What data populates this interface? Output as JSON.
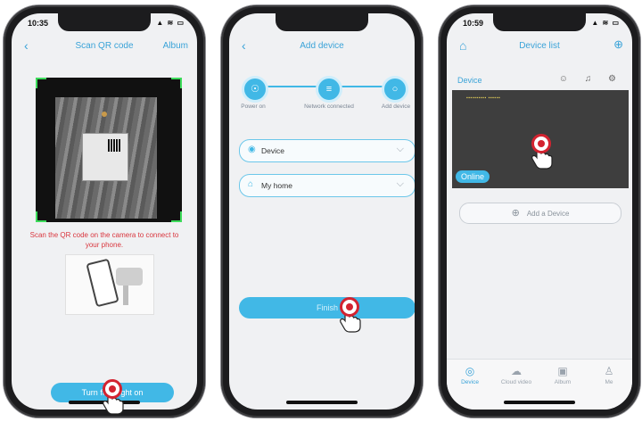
{
  "screens": [
    {
      "status": {
        "time": "10:35",
        "icons": "▲ ≋ ▭"
      },
      "nav": {
        "back": "‹",
        "title": "Scan QR code",
        "right": "Album"
      },
      "scan_instruction": "Scan the QR code on the camera to connect to your phone.",
      "button": "Turn flashlight on"
    },
    {
      "nav": {
        "back": "‹",
        "title": "Add device"
      },
      "steps": [
        {
          "label": "Power on",
          "icon": "☉"
        },
        {
          "label": "Network connected",
          "icon": "≡"
        },
        {
          "label": "Add device",
          "icon": "○"
        }
      ],
      "device_field": {
        "value": "Device",
        "icon": "◉",
        "chevron": "⌵"
      },
      "home_field": {
        "value": "My home",
        "icon": "⌂",
        "chevron": "⌵"
      },
      "button": "Finish"
    },
    {
      "status": {
        "time": "10:59",
        "icons": "▲ ≋ ▭"
      },
      "nav": {
        "left": "⌂",
        "title": "Device list",
        "right": "⊕"
      },
      "device": {
        "name": "Device",
        "icons": "☺ ♫ ⚙",
        "osd": "▪▪▪▪▪▪▪▪▪▪ ▪▪▪▪▪▪",
        "status": "Online"
      },
      "add_label": "Add a Device",
      "add_icon": "⊕",
      "tabs": [
        {
          "label": "Device",
          "icon": "◎"
        },
        {
          "label": "Cloud video",
          "icon": "☁"
        },
        {
          "label": "Album",
          "icon": "▣"
        },
        {
          "label": "Me",
          "icon": "♙"
        }
      ]
    }
  ]
}
